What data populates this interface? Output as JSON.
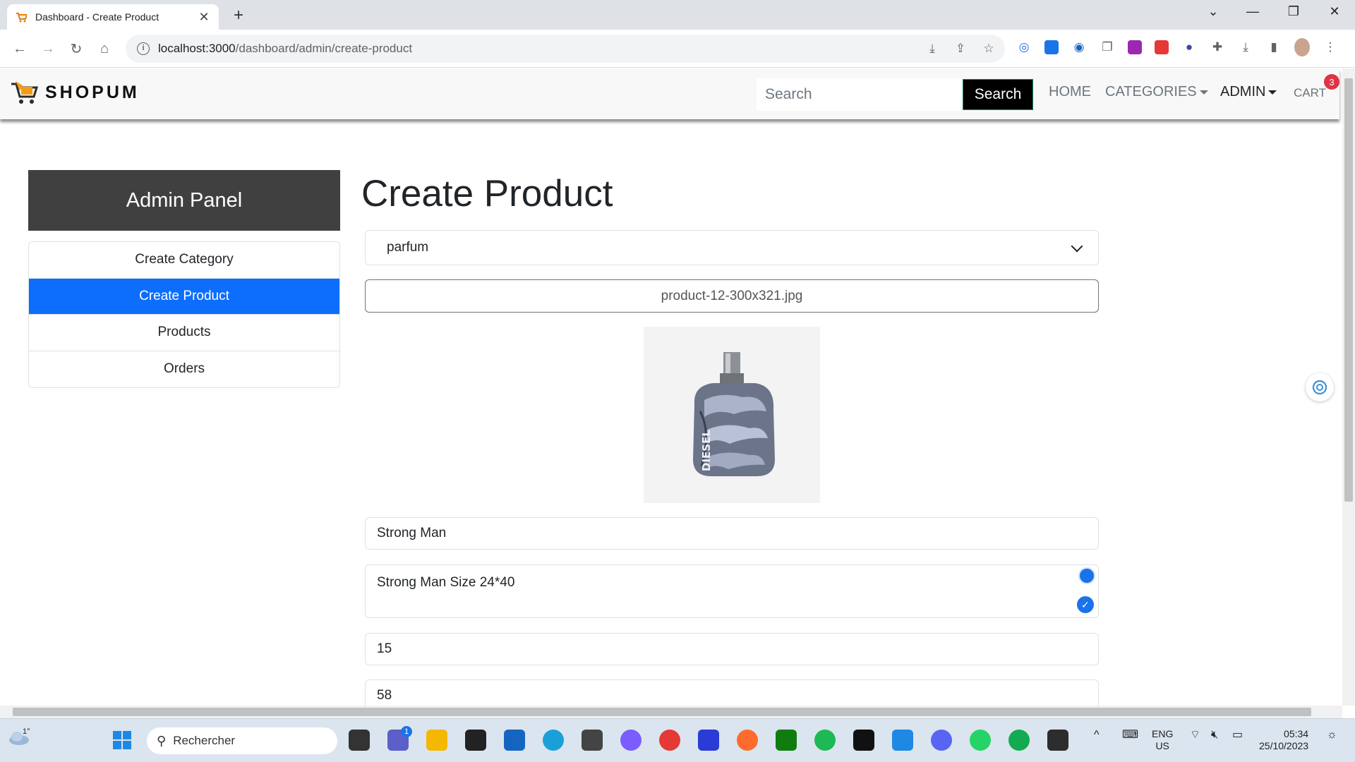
{
  "browser": {
    "tab_title": "Dashboard - Create Product",
    "url_host": "localhost:3000",
    "url_path": "/dashboard/admin/create-product"
  },
  "site": {
    "brand": "SHOPUM",
    "search_placeholder": "Search",
    "search_button": "Search",
    "nav": {
      "home": "HOME",
      "categories": "CATEGORIES",
      "admin": "ADMIN",
      "cart": "CART",
      "cart_count": "3"
    }
  },
  "sidebar": {
    "title": "Admin Panel",
    "items": [
      {
        "label": "Create Category",
        "active": false
      },
      {
        "label": "Create Product",
        "active": true
      },
      {
        "label": "Products",
        "active": false
      },
      {
        "label": "Orders",
        "active": false
      }
    ]
  },
  "form": {
    "heading": "Create Product",
    "category_selected": "parfum",
    "upload_filename": "product-12-300x321.jpg",
    "name": "Strong Man",
    "description": "Strong Man Size 24*40",
    "price": "15",
    "quantity": "58",
    "preview_text": "DIESEL"
  },
  "taskbar": {
    "weather": "1°",
    "search_placeholder": "Rechercher",
    "teams_badge": "1",
    "lang_line1": "ENG",
    "lang_line2": "US",
    "time": "05:34",
    "date": "25/10/2023"
  },
  "colors": {
    "primary": "#0d6efd",
    "panel_header": "#404040",
    "badge": "#dc3545"
  }
}
